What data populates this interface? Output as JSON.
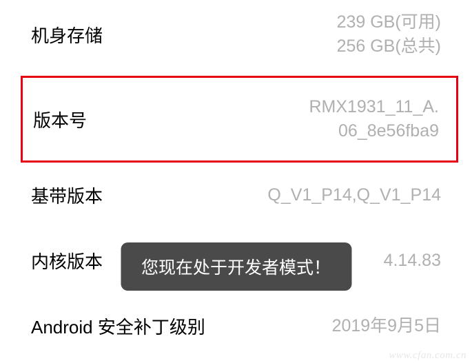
{
  "settings": [
    {
      "label": "机身存储",
      "value": "239 GB(可用)\n256 GB(总共)",
      "highlighted": false
    },
    {
      "label": "版本号",
      "value": "RMX1931_11_A.06_8e56fba9",
      "highlighted": true
    },
    {
      "label": "基带版本",
      "value": "Q_V1_P14,Q_V1_P14",
      "highlighted": false
    },
    {
      "label": "内核版本",
      "value": "4.14.83",
      "highlighted": false
    },
    {
      "label": "Android 安全补丁级别",
      "value": "2019年9月5日",
      "highlighted": false
    }
  ],
  "toast": {
    "message": "您现在处于开发者模式！"
  },
  "watermark": "www.cfan.com.cn"
}
